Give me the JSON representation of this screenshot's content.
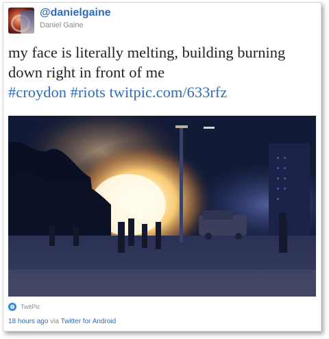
{
  "user": {
    "handle": "@danielgaine",
    "full_name": "Daniel Gaine",
    "avatar_icon": "profile-avatar"
  },
  "tweet": {
    "text_plain": "my face is literally melting, building burning down right in front of me",
    "hashtag_1": "#croydon",
    "hashtag_2": "#riots",
    "link": "twitpic.com/633rfz"
  },
  "media": {
    "source_icon": "twitpic-icon",
    "source_label": "TwitPic"
  },
  "meta": {
    "time": "18 hours ago",
    "via": "via",
    "client": "Twitter for Android"
  },
  "colors": {
    "link": "#2f6cb8",
    "text": "#222222",
    "muted": "#8a8a8a"
  }
}
